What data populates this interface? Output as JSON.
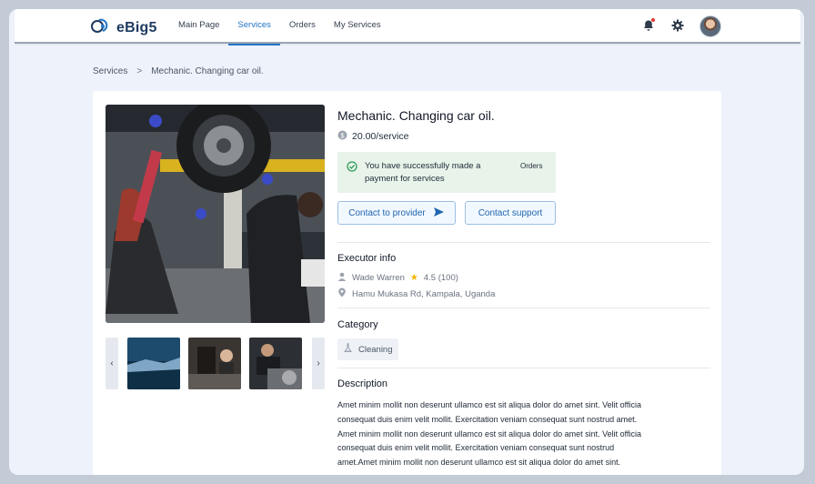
{
  "header": {
    "logo_text": "eBig5",
    "nav": [
      "Main Page",
      "Services",
      "Orders",
      "My Services"
    ],
    "active_nav": "Services"
  },
  "breadcrumb": {
    "parent": "Services",
    "separator": ">",
    "current": "Mechanic. Changing car oil."
  },
  "service": {
    "title": "Mechanic. Changing car oil.",
    "price": "20.00/service",
    "notice_text": "You have successfully made a payment for services",
    "notice_link": "Orders",
    "contact_provider_label": "Contact to provider",
    "contact_support_label": "Contact support"
  },
  "executor": {
    "section_title": "Executor info",
    "name": "Wade Warren",
    "rating": "4.5 (100)",
    "address": "Hamu Mukasa Rd, Kampala, Uganda"
  },
  "category": {
    "section_title": "Category",
    "value": "Cleaning"
  },
  "description": {
    "section_title": "Description",
    "text": "Amet minim mollit non deserunt ullamco est sit aliqua dolor do amet sint. Velit officia consequat duis enim velit mollit. Exercitation veniam consequat sunt nostrud amet. Amet minim mollit non deserunt ullamco est sit aliqua dolor do amet sint. Velit officia consequat duis enim velit mollit. Exercitation veniam consequat sunt nostrud amet.Amet minim mollit non deserunt ullamco est sit aliqua dolor do amet sint."
  },
  "icons": {
    "logo": "logo-icon",
    "bell": "bell-icon",
    "gear": "gear-icon",
    "price": "dollar-coin-icon",
    "success": "check-circle-icon",
    "send": "send-icon",
    "person": "person-icon",
    "star": "star-icon",
    "location": "location-pin-icon",
    "category": "cleaning-icon",
    "prev": "chevron-left-icon",
    "next": "chevron-right-icon"
  },
  "colors": {
    "accent": "#2274c5",
    "notice_bg": "#e8f3ea",
    "success": "#2e9d57",
    "star": "#f4b400",
    "bell_dot": "#e53935"
  }
}
